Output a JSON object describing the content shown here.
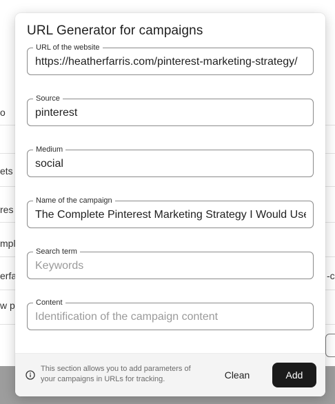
{
  "background": {
    "fragments": [
      "o",
      "ets",
      "res",
      "mpla",
      "erfa",
      "w p"
    ],
    "right_fragment": "-c"
  },
  "modal": {
    "title": "URL Generator for campaigns",
    "fields": [
      {
        "label": "URL of the website",
        "value": "https://heatherfarris.com/pinterest-marketing-strategy/",
        "placeholder": ""
      },
      {
        "label": "Source",
        "value": "pinterest",
        "placeholder": ""
      },
      {
        "label": "Medium",
        "value": "social",
        "placeholder": ""
      },
      {
        "label": "Name of the campaign",
        "value": "The Complete Pinterest Marketing Strategy I Would Use",
        "placeholder": ""
      },
      {
        "label": "Search term",
        "value": "",
        "placeholder": "Keywords"
      },
      {
        "label": "Content",
        "value": "",
        "placeholder": "Identification of the campaign content"
      }
    ],
    "footer": {
      "info_icon": "info-icon",
      "text": "This section allows you to add parameters of your campaigns in URLs for tracking.",
      "clean_label": "Clean",
      "add_label": "Add"
    }
  },
  "colors": {
    "primary_button": "#1b1b1b",
    "footer_bg": "#f4f4f4",
    "field_border": "#8a8a8a"
  }
}
